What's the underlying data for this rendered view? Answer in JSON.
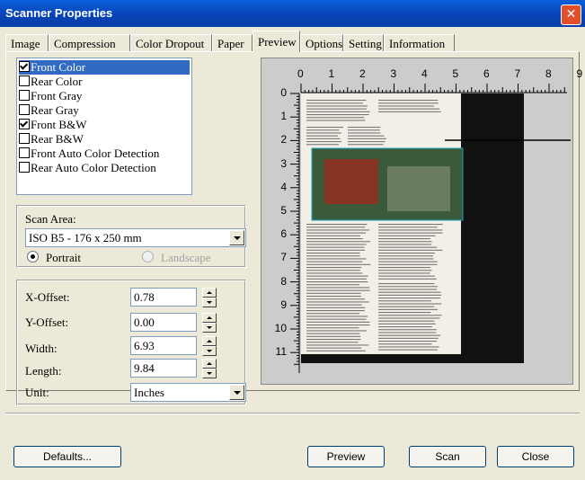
{
  "window": {
    "title": "Scanner Properties"
  },
  "tabs": [
    "Image",
    "Compression",
    "Color Dropout",
    "Paper",
    "Preview",
    "Options",
    "Setting",
    "Information"
  ],
  "active_tab": "Preview",
  "image_list": [
    {
      "label": "Front Color",
      "checked": true,
      "selected": true
    },
    {
      "label": "Rear Color",
      "checked": false,
      "selected": false
    },
    {
      "label": "Front Gray",
      "checked": false,
      "selected": false
    },
    {
      "label": "Rear Gray",
      "checked": false,
      "selected": false
    },
    {
      "label": "Front B&W",
      "checked": true,
      "selected": false
    },
    {
      "label": "Rear B&W",
      "checked": false,
      "selected": false
    },
    {
      "label": "Front Auto Color Detection",
      "checked": false,
      "selected": false
    },
    {
      "label": "Rear Auto Color Detection",
      "checked": false,
      "selected": false
    }
  ],
  "scan_area": {
    "label": "Scan Area:",
    "value": "ISO B5 - 176 x 250 mm",
    "portrait_label": "Portrait",
    "landscape_label": "Landscape"
  },
  "offsets": {
    "x_label": "X-Offset:",
    "x_value": "0.78",
    "y_label": "Y-Offset:",
    "y_value": "0.00",
    "width_label": "Width:",
    "width_value": "6.93",
    "length_label": "Length:",
    "length_value": "9.84",
    "unit_label": "Unit:",
    "unit_value": "Inches"
  },
  "ruler": {
    "h_labels": [
      "0",
      "1",
      "2",
      "3",
      "4",
      "5",
      "6",
      "7",
      "8",
      "9"
    ],
    "v_labels": [
      "0",
      "1",
      "2",
      "3",
      "4",
      "5",
      "6",
      "7",
      "8",
      "9",
      "10",
      "11"
    ]
  },
  "buttons": {
    "defaults": "Defaults...",
    "preview": "Preview",
    "scan": "Scan",
    "close": "Close"
  },
  "colors": {
    "titlebar": "#0842b4",
    "selection": "#316ac5",
    "panel": "#ece9d8"
  }
}
